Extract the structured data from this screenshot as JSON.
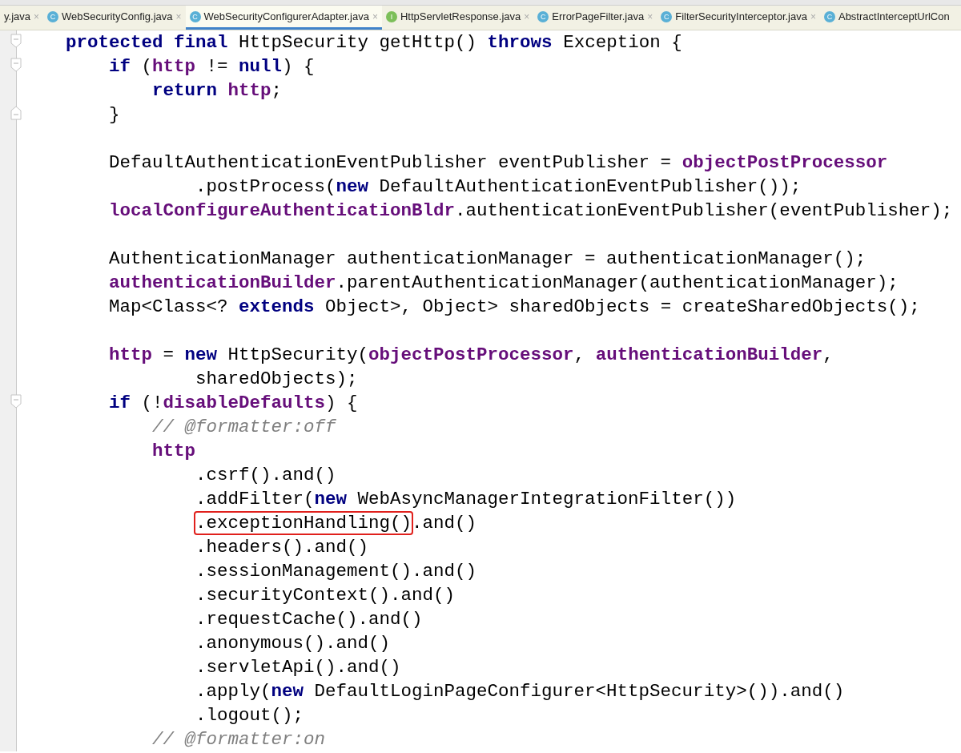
{
  "tabs": [
    {
      "label": "y.java",
      "close": "×",
      "selected": false
    },
    {
      "label": "WebSecurityConfig.java",
      "close": "×",
      "icon": "C",
      "kind": "class",
      "selected": false
    },
    {
      "label": "WebSecurityConfigurerAdapter.java",
      "close": "×",
      "icon": "C",
      "kind": "class",
      "selected": true
    },
    {
      "label": "HttpServletResponse.java",
      "close": "×",
      "icon": "I",
      "kind": "interface",
      "selected": false
    },
    {
      "label": "ErrorPageFilter.java",
      "close": "×",
      "icon": "C",
      "kind": "class",
      "selected": false
    },
    {
      "label": "FilterSecurityInterceptor.java",
      "close": "×",
      "icon": "C",
      "kind": "class",
      "selected": false
    },
    {
      "label": "AbstractInterceptUrlCon",
      "icon": "C",
      "kind": "class",
      "selected": false
    }
  ],
  "code": [
    {
      "kind": "code",
      "fold_start": true,
      "tokens": [
        {
          "t": "protected final ",
          "kind": "kw"
        },
        {
          "t": "HttpSecurity getHttp() ",
          "kind": "plain"
        },
        {
          "t": "throws ",
          "kind": "kw"
        },
        {
          "t": "Exception {",
          "kind": "plain"
        }
      ],
      "children": [
        {
          "kind": "code",
          "fold_start": true,
          "tokens": [
            {
              "t": "if ",
              "kind": "kw"
            },
            {
              "t": "(",
              "kind": "plain"
            },
            {
              "t": "http ",
              "kind": "field"
            },
            {
              "t": "!= ",
              "kind": "plain"
            },
            {
              "t": "null",
              "kind": "kw"
            },
            {
              "t": ") {",
              "kind": "plain"
            }
          ],
          "children": [
            {
              "kind": "code",
              "tokens": [
                {
                  "t": "return ",
                  "kind": "kw"
                },
                {
                  "t": "http",
                  "kind": "field"
                },
                {
                  "t": ";",
                  "kind": "plain"
                }
              ]
            }
          ]
        },
        {
          "kind": "code",
          "fold_end": true,
          "tokens": [
            {
              "t": "}",
              "kind": "plain"
            }
          ]
        },
        {
          "kind": "blank"
        },
        {
          "kind": "code",
          "tokens": [
            {
              "t": "DefaultAuthenticationEventPublisher eventPublisher = ",
              "kind": "plain"
            },
            {
              "t": "objectPostProcessor",
              "kind": "field"
            }
          ],
          "children": [
            {
              "kind": "continuation",
              "tokens": [
                {
                  "t": ".postProcess(",
                  "kind": "plain"
                },
                {
                  "t": "new ",
                  "kind": "kw"
                },
                {
                  "t": "DefaultAuthenticationEventPublisher());",
                  "kind": "plain"
                }
              ]
            }
          ]
        },
        {
          "kind": "code",
          "tokens": [
            {
              "t": "localConfigureAuthenticationBldr",
              "kind": "field"
            },
            {
              "t": ".authenticationEventPublisher(eventPublisher);",
              "kind": "plain"
            }
          ]
        },
        {
          "kind": "blank"
        },
        {
          "kind": "code",
          "tokens": [
            {
              "t": "AuthenticationManager authenticationManager = authenticationManager();",
              "kind": "plain"
            }
          ]
        },
        {
          "kind": "code",
          "tokens": [
            {
              "t": "authenticationBuilder",
              "kind": "field"
            },
            {
              "t": ".parentAuthenticationManager(authenticationManager);",
              "kind": "plain"
            }
          ]
        },
        {
          "kind": "code",
          "tokens": [
            {
              "t": "Map<Class<? ",
              "kind": "plain"
            },
            {
              "t": "extends ",
              "kind": "kw"
            },
            {
              "t": "Object>, Object> sharedObjects = createSharedObjects();",
              "kind": "plain"
            }
          ]
        },
        {
          "kind": "blank"
        },
        {
          "kind": "code",
          "tokens": [
            {
              "t": "http ",
              "kind": "field"
            },
            {
              "t": "= ",
              "kind": "plain"
            },
            {
              "t": "new ",
              "kind": "kw"
            },
            {
              "t": "HttpSecurity(",
              "kind": "plain"
            },
            {
              "t": "objectPostProcessor",
              "kind": "field"
            },
            {
              "t": ", ",
              "kind": "plain"
            },
            {
              "t": "authenticationBuilder",
              "kind": "field"
            },
            {
              "t": ",",
              "kind": "plain"
            }
          ],
          "children": [
            {
              "kind": "continuation",
              "tokens": [
                {
                  "t": "sharedObjects);",
                  "kind": "plain"
                }
              ]
            }
          ]
        },
        {
          "kind": "code",
          "fold_start": true,
          "tokens": [
            {
              "t": "if ",
              "kind": "kw"
            },
            {
              "t": "(!",
              "kind": "plain"
            },
            {
              "t": "disableDefaults",
              "kind": "field"
            },
            {
              "t": ") {",
              "kind": "plain"
            }
          ],
          "children": [
            {
              "kind": "code",
              "tokens": [
                {
                  "t": "// @formatter:off",
                  "kind": "comment"
                }
              ]
            },
            {
              "kind": "code",
              "tokens": [
                {
                  "t": "http",
                  "kind": "field"
                }
              ],
              "children": [
                {
                  "kind": "code",
                  "tokens": [
                    {
                      "t": ".csrf().and()",
                      "kind": "plain"
                    }
                  ]
                },
                {
                  "kind": "code",
                  "tokens": [
                    {
                      "t": ".addFilter(",
                      "kind": "plain"
                    },
                    {
                      "t": "new ",
                      "kind": "kw"
                    },
                    {
                      "t": "WebAsyncManagerIntegrationFilter())",
                      "kind": "plain"
                    }
                  ]
                },
                {
                  "kind": "code",
                  "tokens": [
                    {
                      "t": ".exceptionHandling()",
                      "kind": "plain",
                      "boxed": true
                    },
                    {
                      "t": ".and()",
                      "kind": "plain"
                    }
                  ]
                },
                {
                  "kind": "code",
                  "tokens": [
                    {
                      "t": ".headers().and()",
                      "kind": "plain"
                    }
                  ]
                },
                {
                  "kind": "code",
                  "tokens": [
                    {
                      "t": ".sessionManagement().and()",
                      "kind": "plain"
                    }
                  ]
                },
                {
                  "kind": "code",
                  "tokens": [
                    {
                      "t": ".securityContext().and()",
                      "kind": "plain"
                    }
                  ]
                },
                {
                  "kind": "code",
                  "tokens": [
                    {
                      "t": ".requestCache().and()",
                      "kind": "plain"
                    }
                  ]
                },
                {
                  "kind": "code",
                  "tokens": [
                    {
                      "t": ".anonymous().and()",
                      "kind": "plain"
                    }
                  ]
                },
                {
                  "kind": "code",
                  "tokens": [
                    {
                      "t": ".servletApi().and()",
                      "kind": "plain"
                    }
                  ]
                },
                {
                  "kind": "code",
                  "tokens": [
                    {
                      "t": ".apply(",
                      "kind": "plain"
                    },
                    {
                      "t": "new ",
                      "kind": "kw"
                    },
                    {
                      "t": "DefaultLoginPageConfigurer<HttpSecurity>()).and()",
                      "kind": "plain"
                    }
                  ]
                },
                {
                  "kind": "code",
                  "tokens": [
                    {
                      "t": ".logout();",
                      "kind": "plain"
                    }
                  ]
                }
              ]
            },
            {
              "kind": "code",
              "tokens": [
                {
                  "t": "// @formatter:on",
                  "kind": "comment"
                }
              ]
            }
          ]
        }
      ]
    }
  ]
}
